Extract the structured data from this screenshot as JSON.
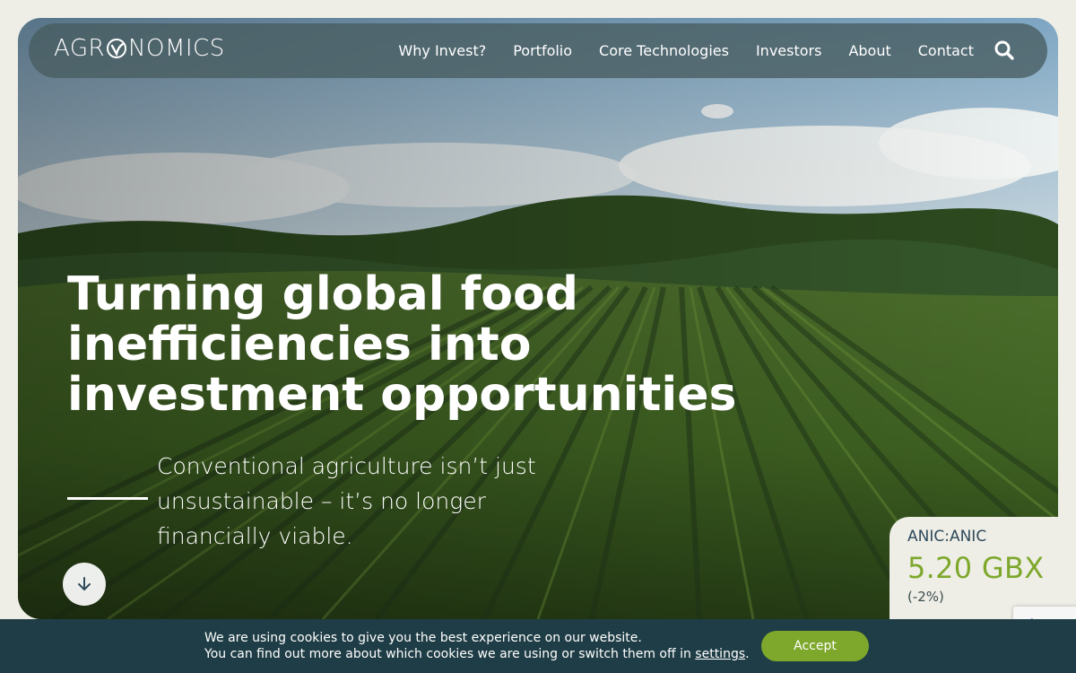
{
  "brand": {
    "logo_text_before": "AGR",
    "logo_text_after": "NOMICS"
  },
  "nav": {
    "items": [
      {
        "label": "Why Invest?"
      },
      {
        "label": "Portfolio"
      },
      {
        "label": "Core Technologies"
      },
      {
        "label": "Investors"
      },
      {
        "label": "About"
      },
      {
        "label": "Contact"
      }
    ],
    "search_icon": "search-icon"
  },
  "hero": {
    "headline": "Turning global food inefficiencies into investment opportunities",
    "subtext": "Conventional agriculture isn’t just unsustainable – it’s no longer financially viable.",
    "scroll_icon": "arrow-down-icon"
  },
  "ticker": {
    "symbol": "ANIC:ANIC",
    "price": "5.20 GBX",
    "change": "(-2%)"
  },
  "cookie": {
    "line1": "We are using cookies to give you the best experience on our website.",
    "line2_prefix": "You can find out more about which cookies we are using or switch them off in ",
    "settings_link": "settings",
    "line2_suffix": ".",
    "accept_label": "Accept"
  },
  "colors": {
    "accent_green": "#7ea82c",
    "cookie_bar": "#1f3d46",
    "page_bg": "#eeeee7"
  }
}
